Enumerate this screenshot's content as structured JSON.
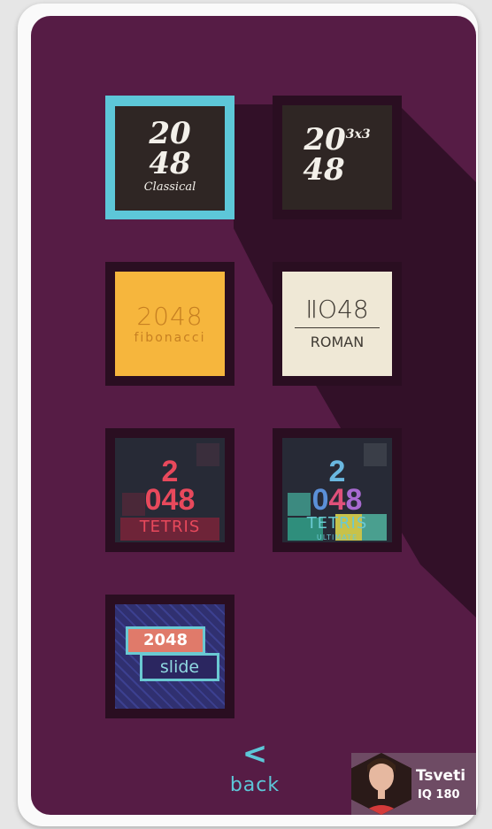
{
  "games": [
    {
      "id": "classical",
      "title_top": "20",
      "title_bottom": "48",
      "subtitle": "Classical"
    },
    {
      "id": "3x3",
      "title_top": "20",
      "title_bottom": "48",
      "superscript": "3x3"
    },
    {
      "id": "fibonacci",
      "title": "2048",
      "subtitle": "fibonacci"
    },
    {
      "id": "roman",
      "title": "ⅡO48",
      "subtitle": "ROMAN"
    },
    {
      "id": "tetris",
      "title_top": "2",
      "title_bottom": "048",
      "subtitle": "TETRIS"
    },
    {
      "id": "tetris-ultimate",
      "title_top": "2",
      "title_bottom": "048",
      "subtitle": "TETRIS",
      "tag": "ULTIMATE"
    },
    {
      "id": "slide",
      "title": "2048",
      "subtitle": "slide"
    }
  ],
  "selected_game": "classical",
  "back": {
    "icon": "<",
    "label": "back"
  },
  "player": {
    "name": "Tsveti",
    "iq": "IQ 180"
  },
  "colors": {
    "background": "#561c45",
    "accent": "#5dc7d8",
    "tile_border": "#2a0e21"
  }
}
